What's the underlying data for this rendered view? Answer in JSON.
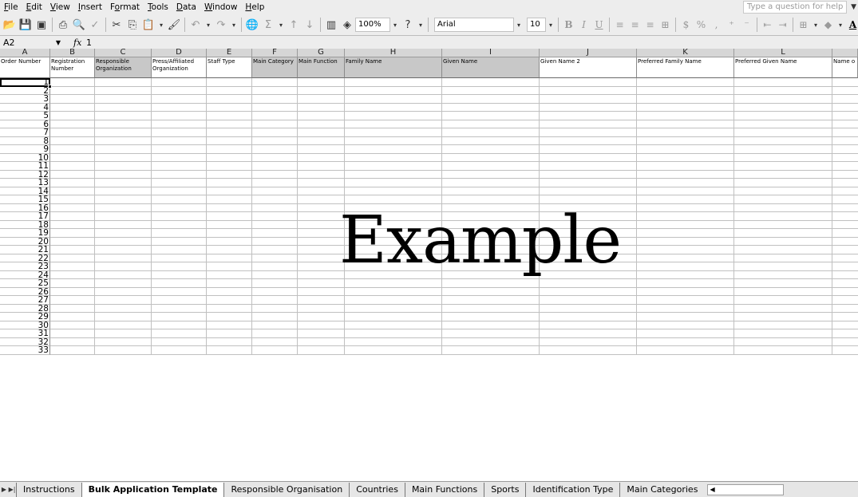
{
  "menu": [
    "File",
    "Edit",
    "View",
    "Insert",
    "Format",
    "Tools",
    "Data",
    "Window",
    "Help"
  ],
  "menu_underline": [
    "F",
    "E",
    "V",
    "I",
    "o",
    "T",
    "D",
    "W",
    "H"
  ],
  "question_box": "Type a question for help",
  "toolbar": {
    "zoom": "100%",
    "font": "Arial",
    "size": "10",
    "bold": "B",
    "italic": "I",
    "underline": "U",
    "percent": "%",
    "comma": ","
  },
  "formula_bar": {
    "name_box": "A2",
    "fx": "fx",
    "value": "1"
  },
  "columns": [
    "A",
    "B",
    "C",
    "D",
    "E",
    "F",
    "G",
    "H",
    "I",
    "J",
    "K",
    "L"
  ],
  "header_row": [
    "Order Number",
    "Registration Number",
    "Responsible Organization",
    "Press/Affiliated Organization",
    "Staff Type",
    "Main Category",
    "Main Function",
    "Family Name",
    "Given Name",
    "Given Name 2",
    "Preferred Family Name",
    "Preferred Given Name",
    "Name o"
  ],
  "row_numbers": [
    "1",
    "2",
    "3",
    "4",
    "5",
    "6",
    "7",
    "8",
    "9",
    "10",
    "11",
    "12",
    "13",
    "14",
    "15",
    "16",
    "17",
    "18",
    "19",
    "20",
    "21",
    "22",
    "23",
    "24",
    "25",
    "26",
    "27",
    "28",
    "29",
    "30",
    "31",
    "32",
    "33"
  ],
  "watermark": "Example",
  "sheet_tabs": [
    "Instructions",
    "Bulk Application Template",
    "Responsible Organisation",
    "Countries",
    "Main Functions",
    "Sports",
    "Identification Type",
    "Main Categories"
  ],
  "active_tab": "Bulk Application Template"
}
